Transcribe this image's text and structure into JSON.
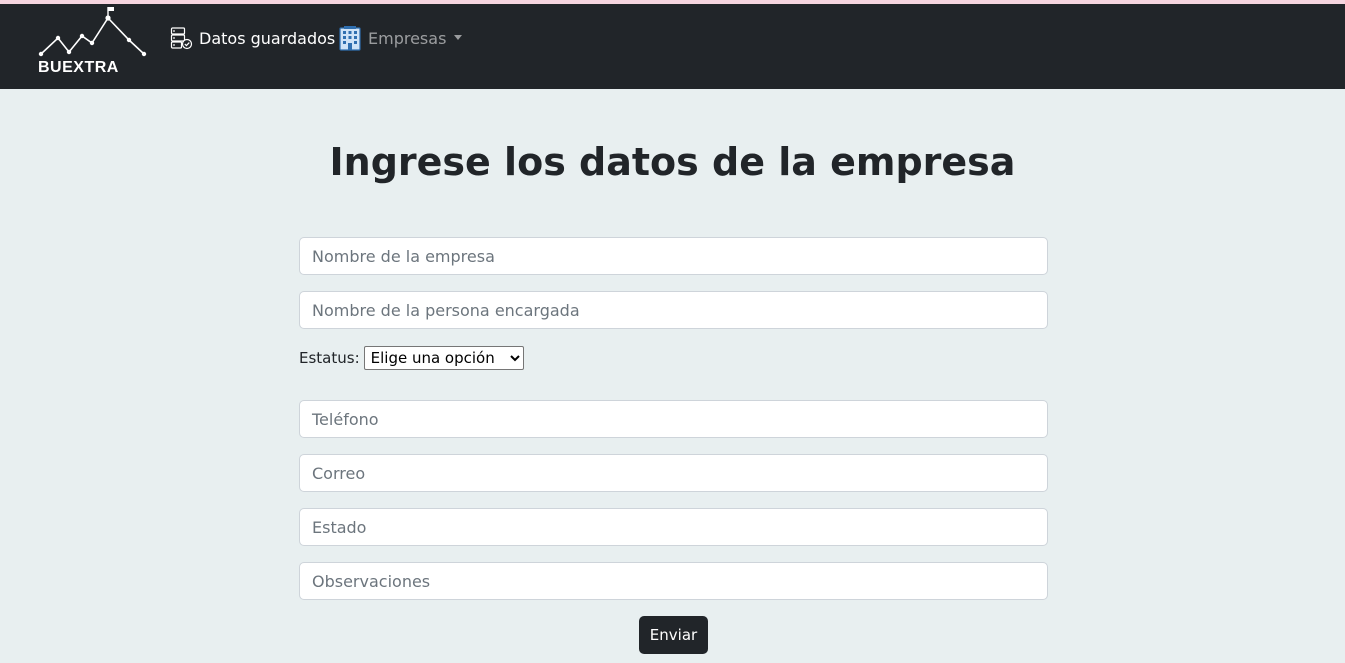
{
  "brand": {
    "name": "BUEXTRA"
  },
  "nav": {
    "saved_label": "Datos guardados",
    "companies_label": "Empresas"
  },
  "form": {
    "title": "Ingrese los datos de la empresa",
    "company_name_placeholder": "Nombre de la empresa",
    "manager_name_placeholder": "Nombre de la persona encargada",
    "status_label": "Estatus:",
    "status_selected": "Elige una opción",
    "phone_placeholder": "Teléfono",
    "email_placeholder": "Correo",
    "state_placeholder": "Estado",
    "notes_placeholder": "Observaciones",
    "submit_label": "Enviar"
  },
  "colors": {
    "navbar": "#212529",
    "page_background": "#e8eff0",
    "button": "#212529"
  },
  "icons": {
    "saved": "server-check-icon",
    "companies": "building-icon",
    "dropdown": "caret-down-icon"
  }
}
